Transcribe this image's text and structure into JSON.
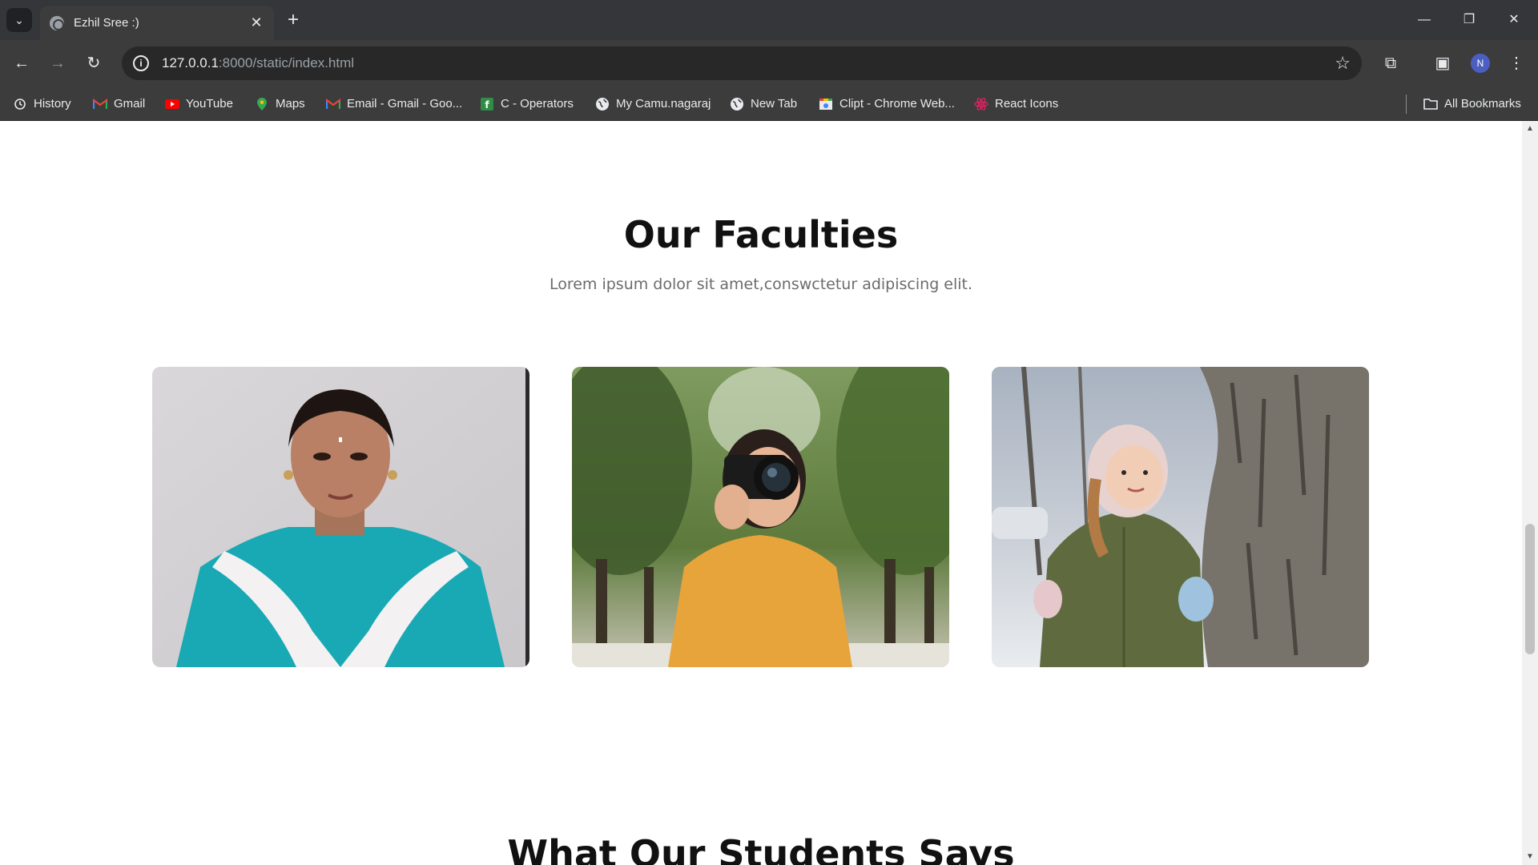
{
  "browser": {
    "tab": {
      "title": "Ezhil Sree :)"
    },
    "url": {
      "host": "127.0.0.1",
      "path": ":8000/static/index.html"
    },
    "avatar_initial": "N",
    "bookmarks": [
      {
        "label": "History",
        "icon": "history-icon"
      },
      {
        "label": "Gmail",
        "icon": "gmail-icon"
      },
      {
        "label": "YouTube",
        "icon": "youtube-icon"
      },
      {
        "label": "Maps",
        "icon": "maps-icon"
      },
      {
        "label": "Email - Gmail - Goo...",
        "icon": "gmail-icon"
      },
      {
        "label": "C - Operators",
        "icon": "c-operators-icon"
      },
      {
        "label": "My Camu.nagaraj",
        "icon": "globe-icon"
      },
      {
        "label": "New Tab",
        "icon": "globe-icon"
      },
      {
        "label": "Clipt - Chrome Web...",
        "icon": "clipt-icon"
      },
      {
        "label": "React Icons",
        "icon": "react-icon"
      }
    ],
    "all_bookmarks": "All Bookmarks"
  },
  "page": {
    "faculties": {
      "title": "Our Faculties",
      "subtitle": "Lorem ipsum dolor sit amet,conswctetur adipiscing elit.",
      "cards": [
        {
          "image": "faculty-portrait-photo"
        },
        {
          "image": "photographer-with-camera-photo"
        },
        {
          "image": "child-by-tree-photo"
        }
      ]
    },
    "next_section_title": "What Our Students Says"
  },
  "colors": {
    "titlebar": "#35363a",
    "toolbar": "#3c3c3c",
    "page_bg": "#ffffff",
    "heading": "#111111",
    "subtitle": "#6b6b6b"
  }
}
